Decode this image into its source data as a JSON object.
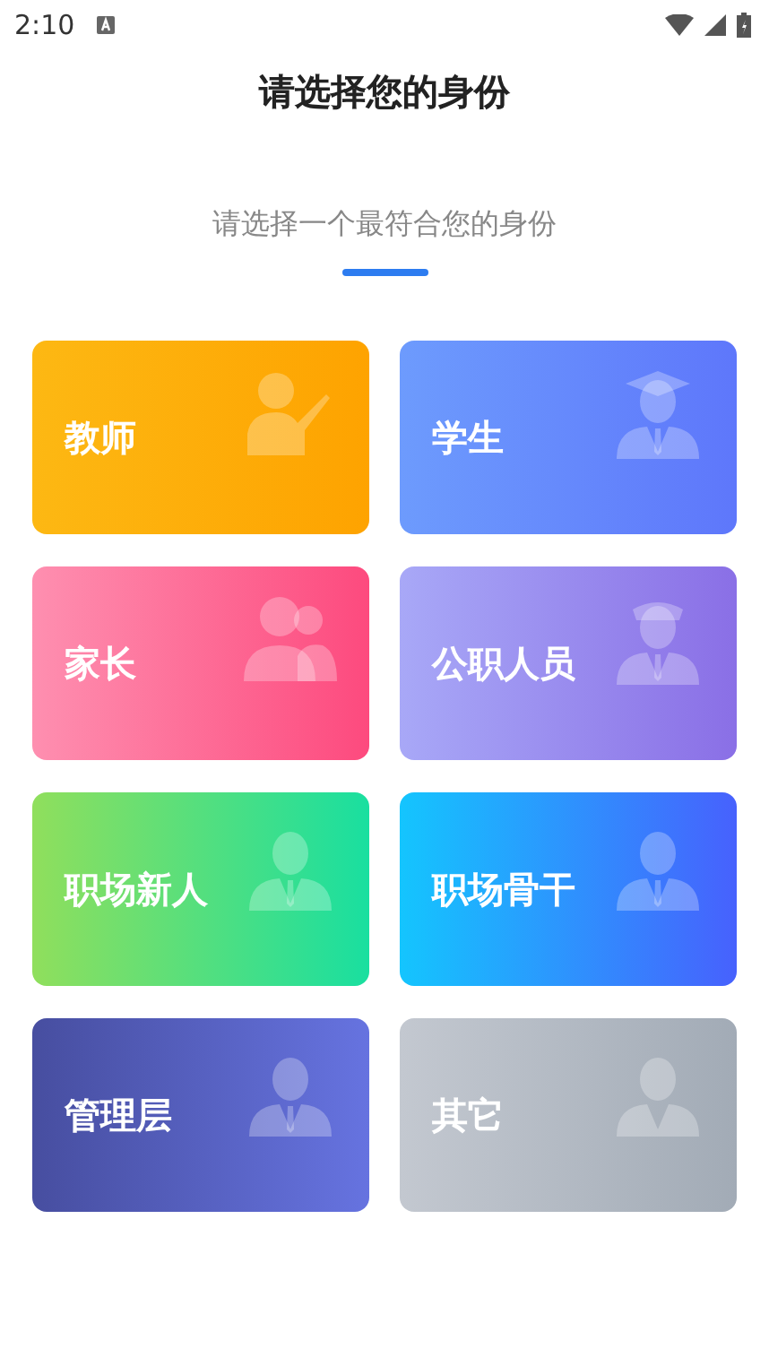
{
  "status_bar": {
    "time": "2:10"
  },
  "header": {
    "title": "请选择您的身份"
  },
  "prompt": {
    "text": "请选择一个最符合您的身份"
  },
  "roles": [
    {
      "label": "教师",
      "kind": "teacher"
    },
    {
      "label": "学生",
      "kind": "student"
    },
    {
      "label": "家长",
      "kind": "parent"
    },
    {
      "label": "公职人员",
      "kind": "officer"
    },
    {
      "label": "职场新人",
      "kind": "newcomer"
    },
    {
      "label": "职场骨干",
      "kind": "employee"
    },
    {
      "label": "管理层",
      "kind": "manager"
    },
    {
      "label": "其它",
      "kind": "other"
    }
  ]
}
